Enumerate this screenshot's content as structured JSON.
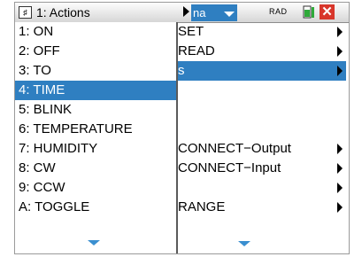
{
  "window": {
    "app_icon": "calculator-page-icon",
    "title": "1: Actions",
    "doc_tab": "na",
    "angle_mode": "RAD",
    "battery_icon": "battery-icon",
    "close_icon": "close-icon",
    "close_glyph": "✕"
  },
  "background_menu": {
    "items": [
      {
        "label": "SET",
        "has_submenu": true
      },
      {
        "label": "READ",
        "has_submenu": true
      },
      {
        "label": "s",
        "has_submenu": true,
        "selected": true
      },
      {
        "label": "",
        "has_submenu": false
      },
      {
        "label": "",
        "has_submenu": false
      },
      {
        "label": "",
        "has_submenu": false
      },
      {
        "label": "CONNECT−Output",
        "has_submenu": true
      },
      {
        "label": "CONNECT−Input",
        "has_submenu": true
      },
      {
        "label": "",
        "has_submenu": true
      },
      {
        "label": "RANGE",
        "has_submenu": true
      }
    ]
  },
  "submenu": {
    "items": [
      "1: ON",
      "2: OFF",
      "3: TO",
      "4: TIME",
      "5: BLINK",
      "6: TEMPERATURE",
      "7: HUMIDITY",
      "8: CW",
      "9: CCW",
      "A: TOGGLE"
    ],
    "highlighted_index": 3
  },
  "colors": {
    "selection": "#2f7fc1",
    "close": "#d8362b",
    "more_arrow": "#3a8fd0"
  }
}
